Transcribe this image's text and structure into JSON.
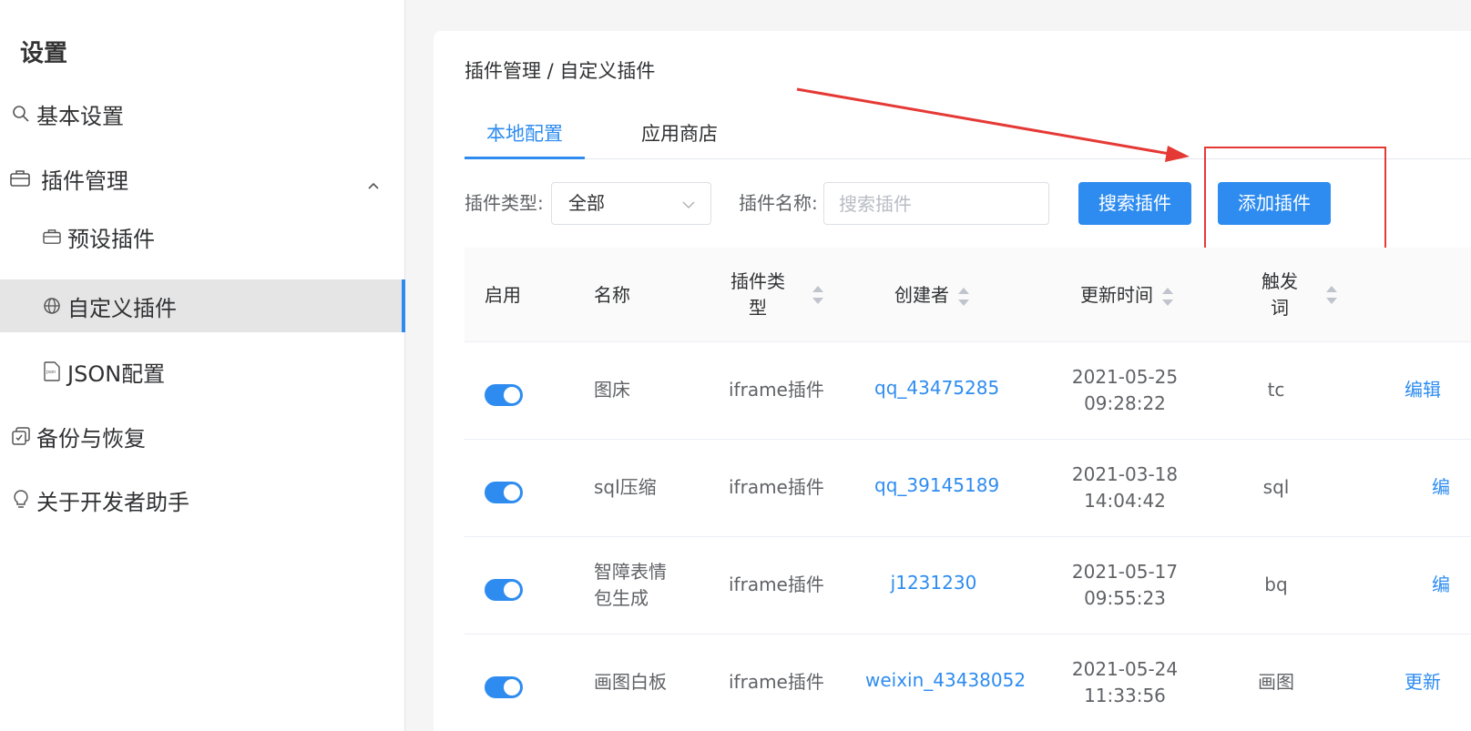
{
  "sidebar": {
    "title": "设置",
    "items": [
      {
        "label": "基本设置",
        "icon": "search-icon"
      },
      {
        "label": "插件管理",
        "icon": "briefcase-icon"
      },
      {
        "label": "预设插件",
        "icon": "briefcase-icon"
      },
      {
        "label": "自定义插件",
        "icon": "globe-icon"
      },
      {
        "label": "JSON配置",
        "icon": "json-file-icon"
      },
      {
        "label": "备份与恢复",
        "icon": "backup-icon"
      },
      {
        "label": "关于开发者助手",
        "icon": "lightbulb-icon"
      }
    ]
  },
  "main": {
    "breadcrumb": "插件管理 / 自定义插件",
    "tabs": [
      {
        "label": "本地配置",
        "active": true
      },
      {
        "label": "应用商店",
        "active": false
      }
    ],
    "filters": {
      "type_label": "插件类型:",
      "type_value": "全部",
      "name_label": "插件名称:",
      "name_placeholder": "搜索插件",
      "search_button": "搜索插件",
      "add_button": "添加插件"
    },
    "table": {
      "headers": [
        "启用",
        "名称",
        "插件类",
        "型",
        "创建者",
        "更新时间",
        "触发",
        "词"
      ],
      "rows": [
        {
          "enabled": true,
          "name": "图床",
          "type": "iframe插件",
          "creator": "qq_43475285",
          "date": "2021-05-25",
          "time": "09:28:22",
          "trigger": "tc",
          "action": "编辑"
        },
        {
          "enabled": true,
          "name": "sql压缩",
          "type": "iframe插件",
          "creator": "qq_39145189",
          "date": "2021-03-18",
          "time": "14:04:42",
          "trigger": "sql",
          "action": "编"
        },
        {
          "enabled": true,
          "name": "智障表情",
          "name2": "包生成",
          "type": "iframe插件",
          "creator": "j1231230",
          "date": "2021-05-17",
          "time": "09:55:23",
          "trigger": "bq",
          "action": "编"
        },
        {
          "enabled": true,
          "name": "画图白板",
          "type": "iframe插件",
          "creator": "weixin_43438052",
          "date": "2021-05-24",
          "time": "11:33:56",
          "trigger": "画图",
          "action": "更新"
        }
      ]
    }
  },
  "colors": {
    "accent": "#2e8cf0",
    "annotation": "#e53935"
  }
}
